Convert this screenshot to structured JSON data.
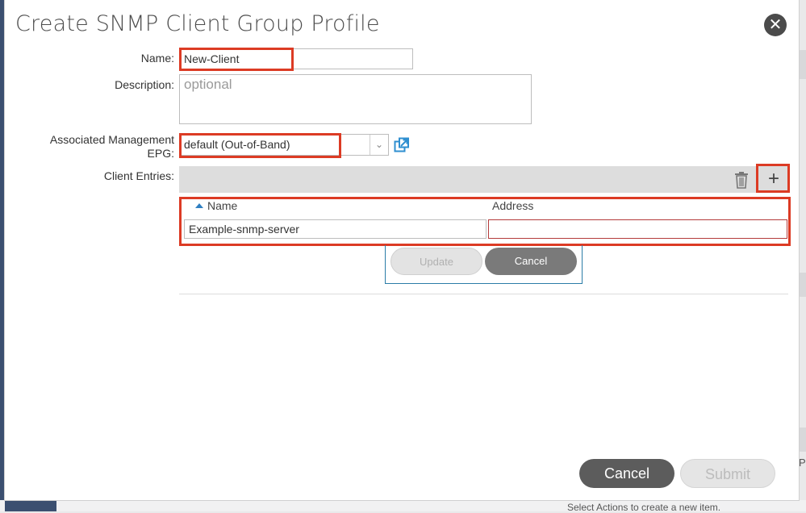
{
  "dialog": {
    "title": "Create SNMP Client Group Profile",
    "close_icon": "close-icon"
  },
  "form": {
    "name_label": "Name:",
    "name_value": "New-Client",
    "description_label": "Description:",
    "description_placeholder": "optional",
    "epg_label_line1": "Associated Management",
    "epg_label_line2": "EPG:",
    "epg_value": "default (Out-of-Band)",
    "client_entries_label": "Client Entries:"
  },
  "client_table": {
    "columns": [
      "Name",
      "Address"
    ],
    "sort_indicator": "sort-ascending-icon",
    "rows": [
      {
        "name": "Example-snmp-server",
        "address": ""
      }
    ],
    "update_label": "Update",
    "cancel_label": "Cancel"
  },
  "footer": {
    "cancel_label": "Cancel",
    "submit_label": "Submit"
  },
  "background": {
    "hint_text": "Select Actions to create a new item.",
    "right_letter": "P"
  },
  "colors": {
    "highlight": "#dc3b24",
    "accent_blue": "#2f7fc1",
    "nav_dark": "#3b4f70"
  }
}
